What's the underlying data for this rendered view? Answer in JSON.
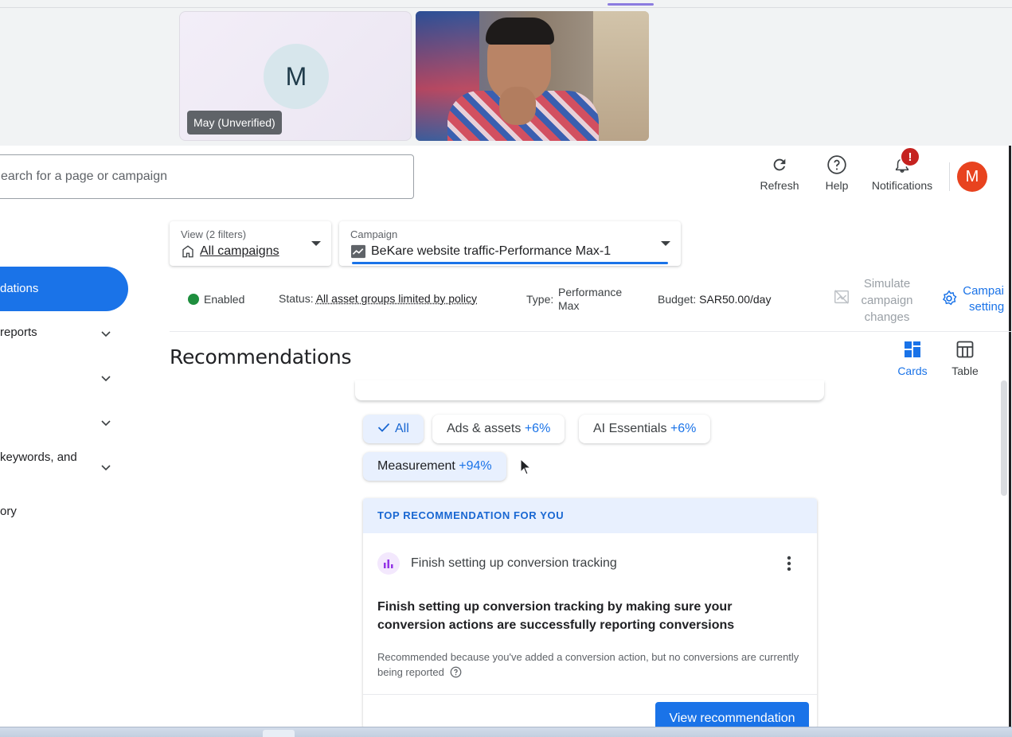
{
  "meet": {
    "participant_initial": "M",
    "participant_name": "May (Unverified)"
  },
  "header": {
    "search_placeholder": "earch for a page or campaign",
    "refresh_label": "Refresh",
    "help_label": "Help",
    "notifications_label": "Notifications",
    "notifications_badge": "!",
    "profile_initial": "M"
  },
  "sidebar": {
    "items": [
      {
        "label": "dations",
        "active": true
      },
      {
        "label": "reports"
      },
      {
        "label": ""
      },
      {
        "label": ""
      },
      {
        "label": "keywords, and"
      },
      {
        "label": "ory"
      }
    ]
  },
  "filters": {
    "view_small": "View (2 filters)",
    "view_value": "All campaigns",
    "campaign_small": "Campaign",
    "campaign_value": "BeKare website traffic-Performance Max-1"
  },
  "status": {
    "enabled": "Enabled",
    "status_label": "Status:",
    "status_value": "All asset groups limited by policy",
    "type_label": "Type:",
    "type_value_line1": "Performance",
    "type_value_line2": "Max",
    "budget_label": "Budget:",
    "budget_value": "SAR50.00/day",
    "simulate_line1": "Simulate",
    "simulate_line2": "campaign",
    "simulate_line3": "changes",
    "settings_line1": "Campai",
    "settings_line2": "setting"
  },
  "page": {
    "title": "Recommendations",
    "cards_label": "Cards",
    "table_label": "Table"
  },
  "chips": [
    {
      "label": "All",
      "pct": "",
      "selected": true
    },
    {
      "label": "Ads & assets",
      "pct": "+6%"
    },
    {
      "label": "AI Essentials",
      "pct": "+6%"
    },
    {
      "label": "Measurement",
      "pct": "+94%"
    }
  ],
  "recommendation": {
    "banner": "TOP RECOMMENDATION FOR YOU",
    "heading": "Finish setting up conversion tracking",
    "title": "Finish setting up conversion tracking by making sure your conversion actions are successfully reporting conversions",
    "reason": "Recommended because you've added a conversion action, but no conversions are currently being reported",
    "button": "View recommendation"
  },
  "colors": {
    "accent": "#1a73e8",
    "status_green": "#1e8e3e",
    "profile": "#e8431f",
    "badge": "#c5221f"
  }
}
